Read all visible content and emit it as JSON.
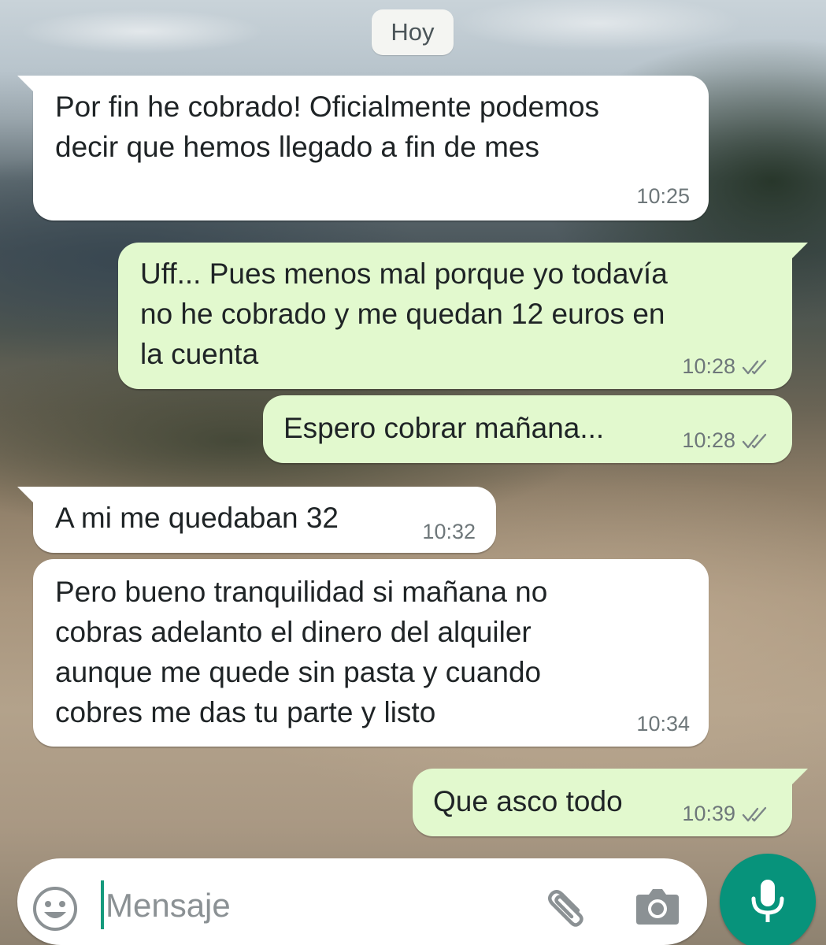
{
  "date_divider": "Hoy",
  "messages": [
    {
      "direction": "in",
      "text": "Por fin he cobrado! Oficialmente podemos\ndecir que hemos llegado a fin de mes",
      "time": "10:25"
    },
    {
      "direction": "out",
      "text": "Uff... Pues menos mal porque yo todavía\nno he cobrado y me quedan 12 euros en\nla cuenta",
      "time": "10:28",
      "status": "read-double-check"
    },
    {
      "direction": "out",
      "text": "Espero cobrar mañana...",
      "time": "10:28",
      "status": "read-double-check"
    },
    {
      "direction": "in",
      "text": "A mi me quedaban 32",
      "time": "10:32"
    },
    {
      "direction": "in",
      "text": "Pero bueno tranquilidad si mañana no\ncobras adelanto el dinero del alquiler\naunque me quede sin pasta y cuando\ncobres me das tu parte y listo",
      "time": "10:34"
    },
    {
      "direction": "out",
      "text": "Que asco todo",
      "time": "10:39",
      "status": "read-double-check"
    }
  ],
  "composer": {
    "placeholder": "Mensaje",
    "emoji_icon": "emoji-icon",
    "attach_icon": "paperclip-icon",
    "camera_icon": "camera-icon",
    "send_icon": "microphone-icon"
  },
  "colors": {
    "incoming_bubble": "#ffffff",
    "outgoing_bubble": "#e2f9ce",
    "accent": "#07937b",
    "meta_text": "#6e777a"
  }
}
